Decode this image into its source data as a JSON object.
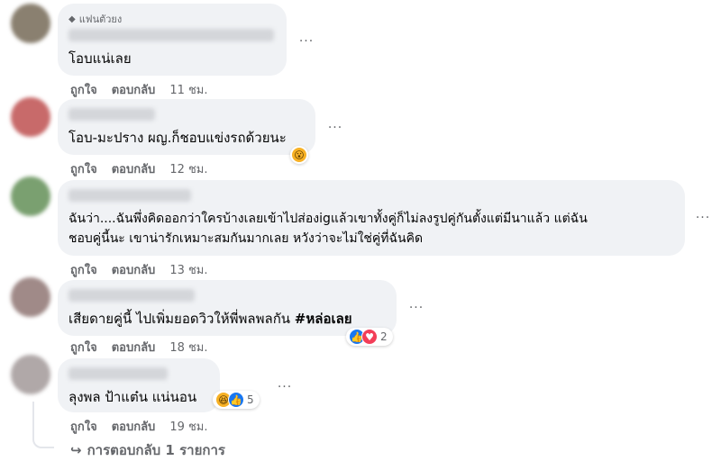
{
  "colors": {
    "bubble": "#f0f2f5",
    "secondary_text": "#65676b",
    "like_blue": "#1877f2",
    "love_red": "#f33e58",
    "haha_yellow": "#f7b125"
  },
  "comments": [
    {
      "badge": "แฟนตัวยง",
      "text": "โอบแน่เลย",
      "like": "ถูกใจ",
      "reply": "ตอบกลับ",
      "time": "11 ชม.",
      "avatar_color": "#8a8070"
    },
    {
      "text": "โอบ-มะปราง ผญ.ก็ชอบแข่งรถด้วยนะ",
      "like": "ถูกใจ",
      "reply": "ตอบกลับ",
      "time": "12 ชม.",
      "reactions": [
        "wow-icon"
      ],
      "avatar_color": "#c86a6a"
    },
    {
      "text_line1": "ฉันว่า....ฉันพึ่งคิดออกว่าใครบ้างเลยเข้าไปส่องigแล้วเขาทั้งคู่ก็ไม่ลงรูปคู่กันตั้งแต่มีนาแล้ว แต่ฉัน",
      "text_line2": "ชอบคู่นี้นะ เขาน่ารักเหมาะสมกันมากเลย หวังว่าจะไม่ใช่คู่ที่ฉันคิด",
      "like": "ถูกใจ",
      "reply": "ตอบกลับ",
      "time": "13 ชม.",
      "avatar_color": "#7aa070"
    },
    {
      "text": "เสียดายคู่นี้ ไปเพิ่มยอดวิวให้พี่พลพลกัน ",
      "hashtag": "#หล่อเลย",
      "like": "ถูกใจ",
      "reply": "ตอบกลับ",
      "time": "18 ชม.",
      "reaction_count": "2",
      "avatar_color": "#a08a88"
    },
    {
      "text": "ลุงพล ป้าแต๋น แน่นอน",
      "like": "ถูกใจ",
      "reply": "ตอบกลับ",
      "time": "19 ชม.",
      "reaction_count": "5",
      "avatar_color": "#b0a8a8"
    }
  ],
  "replies_link": "การตอบกลับ 1 รายการ",
  "more_glyph": "···"
}
